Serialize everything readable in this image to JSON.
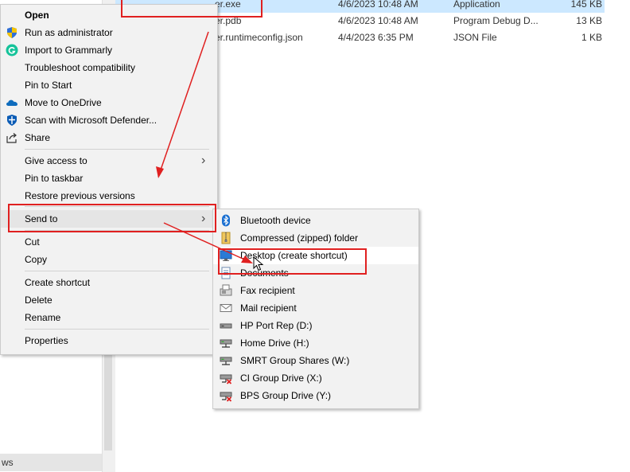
{
  "explorer": {
    "nav_bottom_label": "ws",
    "files": [
      {
        "name": "er.exe",
        "date": "4/6/2023 10:48 AM",
        "type": "Application",
        "size": "145 KB",
        "selected": true
      },
      {
        "name": "er.pdb",
        "date": "4/6/2023 10:48 AM",
        "type": "Program Debug D...",
        "size": "13 KB"
      },
      {
        "name": "er.runtimeconfig.json",
        "date": "4/4/2023 6:35 PM",
        "type": "JSON File",
        "size": "1 KB"
      }
    ]
  },
  "context_menu": {
    "items": [
      {
        "label": "Open",
        "bold": true
      },
      {
        "label": "Run as administrator",
        "icon": "shield-icon"
      },
      {
        "label": "Import to Grammarly",
        "icon": "grammarly-icon"
      },
      {
        "label": "Troubleshoot compatibility"
      },
      {
        "label": "Pin to Start"
      },
      {
        "label": "Move to OneDrive",
        "icon": "onedrive-icon"
      },
      {
        "label": "Scan with Microsoft Defender...",
        "icon": "defender-icon"
      },
      {
        "label": "Share",
        "icon": "share-icon"
      },
      {
        "label": "Give access to",
        "submenu": true
      },
      {
        "label": "Pin to taskbar"
      },
      {
        "label": "Restore previous versions"
      },
      {
        "label": "Send to",
        "submenu": true
      },
      {
        "label": "Cut"
      },
      {
        "label": "Copy"
      },
      {
        "label": "Create shortcut"
      },
      {
        "label": "Delete"
      },
      {
        "label": "Rename"
      },
      {
        "label": "Properties"
      }
    ]
  },
  "send_to_menu": {
    "items": [
      {
        "label": "Bluetooth device",
        "icon": "bluetooth-icon"
      },
      {
        "label": "Compressed (zipped) folder",
        "icon": "zip-folder-icon"
      },
      {
        "label": "Desktop (create shortcut)",
        "icon": "desktop-icon",
        "hovered": true
      },
      {
        "label": "Documents",
        "icon": "documents-icon"
      },
      {
        "label": "Fax recipient",
        "icon": "fax-icon"
      },
      {
        "label": "Mail recipient",
        "icon": "mail-icon"
      },
      {
        "label": "HP Port Rep (D:)",
        "icon": "drive-icon"
      },
      {
        "label": "Home Drive (H:)",
        "icon": "network-drive-icon"
      },
      {
        "label": "SMRT Group Shares (W:)",
        "icon": "network-drive-icon"
      },
      {
        "label": "CI Group Drive (X:)",
        "icon": "disconnected-drive-icon"
      },
      {
        "label": "BPS Group Drive (Y:)",
        "icon": "disconnected-drive-icon"
      }
    ]
  },
  "colors": {
    "annotation_red": "#e02020",
    "selection_blue": "#cce8ff",
    "menu_bg": "#f2f2f2"
  }
}
